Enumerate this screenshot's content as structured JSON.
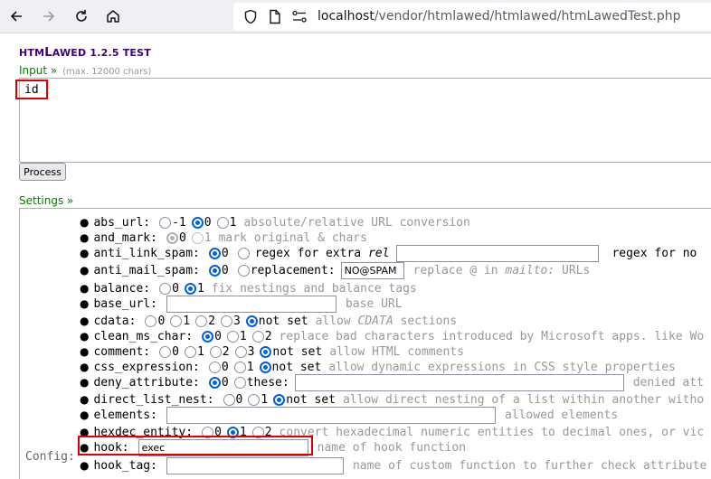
{
  "browser": {
    "url_host": "localhost",
    "url_path": "/vendor/htmlawed/htmlawed/htmLawedTest.php",
    "icons": [
      "back-arrow-icon",
      "forward-arrow-icon",
      "reload-icon",
      "home-icon",
      "shield-icon",
      "page-icon",
      "connection-icon"
    ]
  },
  "page": {
    "title_prefix": "htm",
    "title_big": "L",
    "title_rest": "awed 1.2.5 test",
    "input_label": "Input »",
    "input_note": "(max. 12000 chars)",
    "input_value": "id",
    "process_label": "Process",
    "settings_label": "Settings »",
    "config_label": "Config:"
  },
  "settings": {
    "abs_url": {
      "key": "abs_url:",
      "options": [
        "-1",
        "0",
        "1"
      ],
      "checked": 1,
      "desc": "absolute/relative URL conversion"
    },
    "and_mark": {
      "key": "and_mark:",
      "options": [
        "0",
        "1"
      ],
      "checked": 0,
      "desc": "mark original & chars"
    },
    "anti_link_spam": {
      "key": "anti_link_spam:",
      "opt0": "0",
      "text1": "regex for extra",
      "text1_em": "rel",
      "text2": "regex for no"
    },
    "anti_mail_spam": {
      "key": "anti_mail_spam:",
      "opt0": "0",
      "text1": "replacement:",
      "value": "NO@SPAM",
      "desc": "replace @ in",
      "desc_em": "mailto:",
      "desc2": "URLs"
    },
    "balance": {
      "key": "balance:",
      "options": [
        "0",
        "1"
      ],
      "checked": 1,
      "desc": "fix nestings and balance tags"
    },
    "base_url": {
      "key": "base_url:",
      "desc": "base URL"
    },
    "cdata": {
      "key": "cdata:",
      "options": [
        "0",
        "1",
        "2",
        "3",
        "not set"
      ],
      "checked": 4,
      "desc": "allow",
      "desc_em": "CDATA",
      "desc2": "sections"
    },
    "clean_ms_char": {
      "key": "clean_ms_char:",
      "options": [
        "0",
        "1",
        "2"
      ],
      "checked": 0,
      "desc": "replace bad characters introduced by Microsoft apps. like Wo"
    },
    "comment": {
      "key": "comment:",
      "options": [
        "0",
        "1",
        "2",
        "3",
        "not set"
      ],
      "checked": 4,
      "desc": "allow HTML comments"
    },
    "css_expression": {
      "key": "css_expression:",
      "options": [
        "0",
        "1",
        "not set"
      ],
      "checked": 2,
      "desc": "allow dynamic expressions in CSS style properties"
    },
    "deny_attribute": {
      "key": "deny_attribute:",
      "opt0": "0",
      "text1": "these:",
      "desc": "denied att"
    },
    "direct_list_nest": {
      "key": "direct_list_nest:",
      "options": [
        "0",
        "1",
        "not set"
      ],
      "checked": 2,
      "desc": "allow direct nesting of a list within another witho"
    },
    "elements": {
      "key": "elements:",
      "desc": "allowed elements"
    },
    "hexdec_entity": {
      "key": "hexdec_entity:",
      "options": [
        "0",
        "1",
        "2"
      ],
      "checked": 1,
      "desc": "convert hexadecimal numeric entities to decimal ones, or vic"
    },
    "hook": {
      "key": "hook:",
      "value": "exec",
      "desc": "name of hook function"
    },
    "hook_tag": {
      "key": "hook_tag:",
      "desc": "name of custom function to further check attribute v"
    }
  },
  "colors": {
    "title": "#400080",
    "label_green": "#008000",
    "description_gray": "#999999",
    "radio_blue": "#0060df",
    "highlight_red": "#e00000"
  }
}
